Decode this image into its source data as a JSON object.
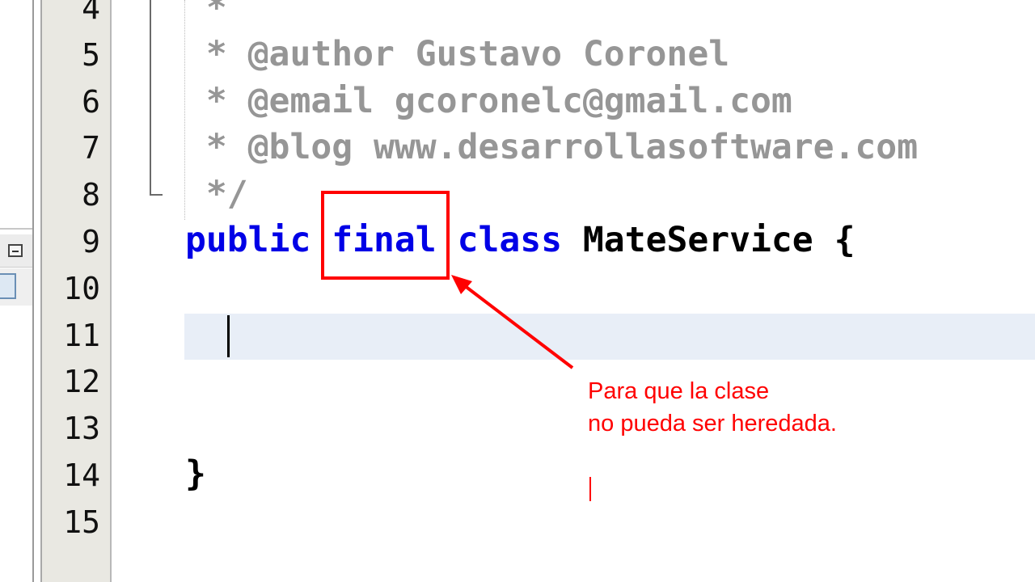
{
  "gutter": {
    "line_numbers": [
      "4",
      "5",
      "6",
      "7",
      "8",
      "9",
      "10",
      "11",
      "12",
      "13",
      "14",
      "15"
    ]
  },
  "code": {
    "line4": " *",
    "line5": " * @author Gustavo Coronel",
    "line6": " * @email gcoronelc@gmail.com",
    "line7": " * @blog www.desarrollasoftware.com",
    "line8": " */",
    "line9_kw1": "public",
    "line9_kw2": "final",
    "line9_kw3": "class",
    "line9_rest": "MateService {",
    "line14": "}"
  },
  "annotation": {
    "line1": "Para que la clase",
    "line2": "no pueda ser heredada.",
    "color": "#ff0000"
  }
}
